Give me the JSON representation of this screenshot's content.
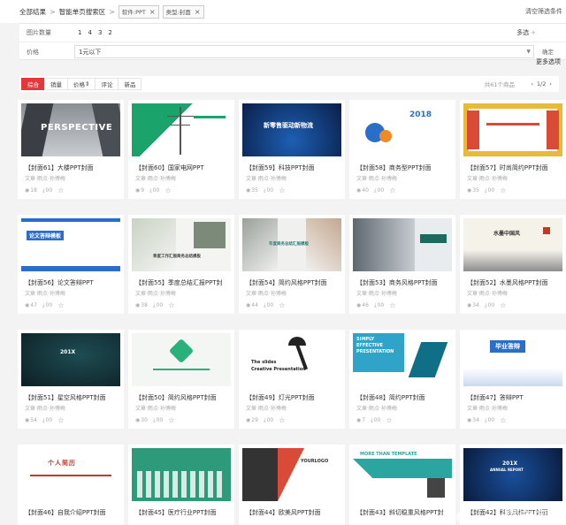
{
  "breadcrumb": {
    "all": "全部结果",
    "section": "智能单页搜索区",
    "tags": [
      "软件:PPT",
      "类型:封面"
    ],
    "clear": "清空筛选条件"
  },
  "filters": {
    "image_count_label": "图片数量",
    "image_count_options": [
      "1",
      "4",
      "3",
      "2"
    ],
    "multi": "多选",
    "price_label": "价格",
    "price_value": "1元以下",
    "confirm": "确定",
    "more": "更多选项"
  },
  "sortbar": {
    "tabs": [
      "综合",
      "销量",
      "价格",
      "评论",
      "新品"
    ],
    "active": 0,
    "count": "共61个商品",
    "page": "1/2"
  },
  "cards": [
    {
      "title": "【封面61】大楼PPT封面",
      "sub": "文章·雨点·孙博梅",
      "views": "18",
      "dl": "00",
      "thumb": "building"
    },
    {
      "title": "【封面60】国家电网PPT",
      "sub": "文章·雨点·孙博梅",
      "views": "9",
      "dl": "00",
      "thumb": "grid"
    },
    {
      "title": "【封面59】科技PPT封面",
      "sub": "文章·雨点·孙博梅",
      "views": "35",
      "dl": "00",
      "thumb": "tech"
    },
    {
      "title": "【封面58】商务型PPT封面",
      "sub": "文章·雨点·孙博梅",
      "views": "40",
      "dl": "00",
      "thumb": "business"
    },
    {
      "title": "【封面57】时尚简约PPT封面",
      "sub": "文章·雨点·孙博梅",
      "views": "35",
      "dl": "00",
      "thumb": "fashion"
    },
    {
      "title": "【封面56】论文答辩PPT",
      "sub": "文章·雨点·孙博梅",
      "views": "47",
      "dl": "00",
      "thumb": "thesis"
    },
    {
      "title": "【封面55】季度总结汇报PPT封",
      "sub": "文章·雨点·孙博梅",
      "views": "38",
      "dl": "00",
      "thumb": "quarter"
    },
    {
      "title": "【封面54】简约风格PPT封面",
      "sub": "文章·雨点·孙博梅",
      "views": "44",
      "dl": "00",
      "thumb": "simple"
    },
    {
      "title": "【封面53】商务风格PPT封面",
      "sub": "文章·雨点·孙博梅",
      "views": "46",
      "dl": "00",
      "thumb": "handshake"
    },
    {
      "title": "【封面52】水墨风格PPT封面",
      "sub": "文章·雨点·孙博梅",
      "views": "34",
      "dl": "00",
      "thumb": "ink"
    },
    {
      "title": "【封面51】星空风格PPT封面",
      "sub": "文章·雨点·孙博梅",
      "views": "54",
      "dl": "00",
      "thumb": "starry"
    },
    {
      "title": "【封面50】简约风格PPT封面",
      "sub": "文章·雨点·孙博梅",
      "views": "30",
      "dl": "00",
      "thumb": "hexagon"
    },
    {
      "title": "【封面49】灯光PPT封面",
      "sub": "文章·雨点·孙博梅",
      "views": "29",
      "dl": "00",
      "thumb": "lamp"
    },
    {
      "title": "【封面48】简约PPT封面",
      "sub": "文章·雨点·孙博梅",
      "views": "7",
      "dl": "00",
      "thumb": "effective"
    },
    {
      "title": "【封面47】答辩PPT",
      "sub": "文章·雨点·孙博梅",
      "views": "34",
      "dl": "00",
      "thumb": "defense"
    },
    {
      "title": "【封面46】自我介绍PPT封面",
      "sub": "",
      "views": "",
      "dl": "",
      "thumb": "intro"
    },
    {
      "title": "【封面45】医疗行业PPT封面",
      "sub": "",
      "views": "",
      "dl": "",
      "thumb": "medical"
    },
    {
      "title": "【封面44】欧美风PPT封面",
      "sub": "",
      "views": "",
      "dl": "",
      "thumb": "euro"
    },
    {
      "title": "【封面43】斜切稳重风格PPT封",
      "sub": "",
      "views": "",
      "dl": "",
      "thumb": "template"
    },
    {
      "title": "【封面42】科技风格PPT封面",
      "sub": "",
      "views": "",
      "dl": "",
      "thumb": "report"
    }
  ],
  "thumb_text": {
    "building": "PERSPECTIVE",
    "tech": "新零售驱动新物流",
    "business_num": "2018",
    "thesis": "论文答辩模板",
    "quarter": "季度工作汇报商务总结模板",
    "simple": "年度商务总结汇报模板",
    "ink": "水墨中国风",
    "starry": "201X",
    "lamp_1": "The slides",
    "lamp_2": "Creative Presentation",
    "effective_1": "SIMPLY",
    "effective_2": "EFFECTIVE",
    "effective_3": "PRESENTATION",
    "defense": "毕业答辩",
    "intro": "个人简历",
    "euro": "YOURLOGO",
    "template": "MORE THAN TEMPLATE",
    "report_1": "201X",
    "report_2": "ANNUAL REPORT"
  },
  "watermark": "悟空问答",
  "colors": {
    "accent": "#e4393c"
  }
}
